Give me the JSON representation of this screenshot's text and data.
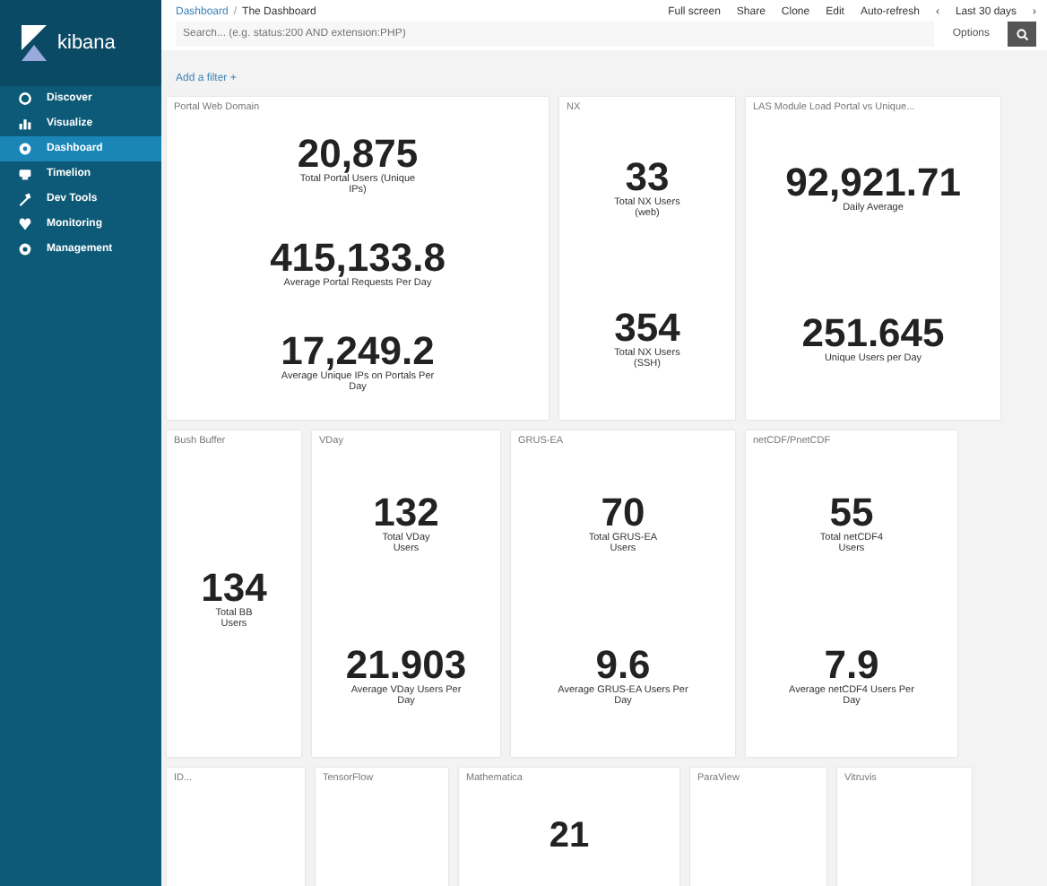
{
  "sidebar": {
    "logo_text": "kibana",
    "items": [
      {
        "label": "Discover",
        "selected": false
      },
      {
        "label": "Visualize",
        "selected": false
      },
      {
        "label": "Dashboard",
        "selected": true
      },
      {
        "label": "Timelion",
        "selected": false
      },
      {
        "label": "Dev Tools",
        "selected": false
      },
      {
        "label": "Monitoring",
        "selected": false
      },
      {
        "label": "Management",
        "selected": false
      }
    ]
  },
  "top_bar": {
    "breadcrumb": [
      "Dashboard",
      "The Dashboard"
    ],
    "separator": "/",
    "actions": [
      "Full screen",
      "Share",
      "Clone",
      "Edit",
      "Auto-refresh",
      "‹",
      "Last 30 days",
      "›"
    ]
  },
  "search": {
    "placeholder": "Search... (e.g. status:200 AND extension:PHP)",
    "options": "Options"
  },
  "filter_link": "Add a filter +",
  "rows": [
    [
      {
        "title": "Portal Web Domain",
        "metrics": [
          {
            "value": "20,875",
            "label": "Total Portal Users (Unique IPs)"
          },
          {
            "value": "415,133.8",
            "label": "Average Portal Requests Per Day"
          },
          {
            "value": "17,249.2",
            "label": "Average Unique IPs on Portals Per Day"
          }
        ]
      },
      {
        "title": "NX",
        "metrics": [
          {
            "value": "33",
            "label": "Total NX Users (web)"
          },
          {
            "value": "354",
            "label": "Total NX Users (SSH)"
          }
        ]
      },
      {
        "title": "LAS Module Load Portal vs Unique...",
        "metrics": [
          {
            "value": "92,921.71",
            "label": "Daily Average"
          },
          {
            "value": "251.645",
            "label": "Unique Users per Day"
          }
        ]
      }
    ],
    [
      {
        "title": "Bush Buffer",
        "metrics": [
          {
            "value": "134",
            "label": "Total BB Users"
          }
        ]
      },
      {
        "title": "VDay",
        "metrics": [
          {
            "value": "132",
            "label": "Total VDay Users"
          },
          {
            "value": "21.903",
            "label": "Average VDay Users Per Day"
          }
        ]
      },
      {
        "title": "GRUS-EA",
        "metrics": [
          {
            "value": "70",
            "label": "Total GRUS-EA Users"
          },
          {
            "value": "9.6",
            "label": "Average GRUS-EA Users Per Day"
          }
        ]
      },
      {
        "title": "netCDF/PnetCDF",
        "metrics": [
          {
            "value": "55",
            "label": "Total netCDF4 Users"
          },
          {
            "value": "7.9",
            "label": "Average netCDF4 Users Per Day"
          }
        ]
      }
    ],
    [
      {
        "title": "ID..."
      },
      {
        "title": "TensorFlow"
      },
      {
        "title": "Mathematica",
        "metrics": [
          {
            "value": "21"
          }
        ]
      },
      {
        "title": "ParaView"
      },
      {
        "title": "Vitruvis"
      }
    ]
  ]
}
